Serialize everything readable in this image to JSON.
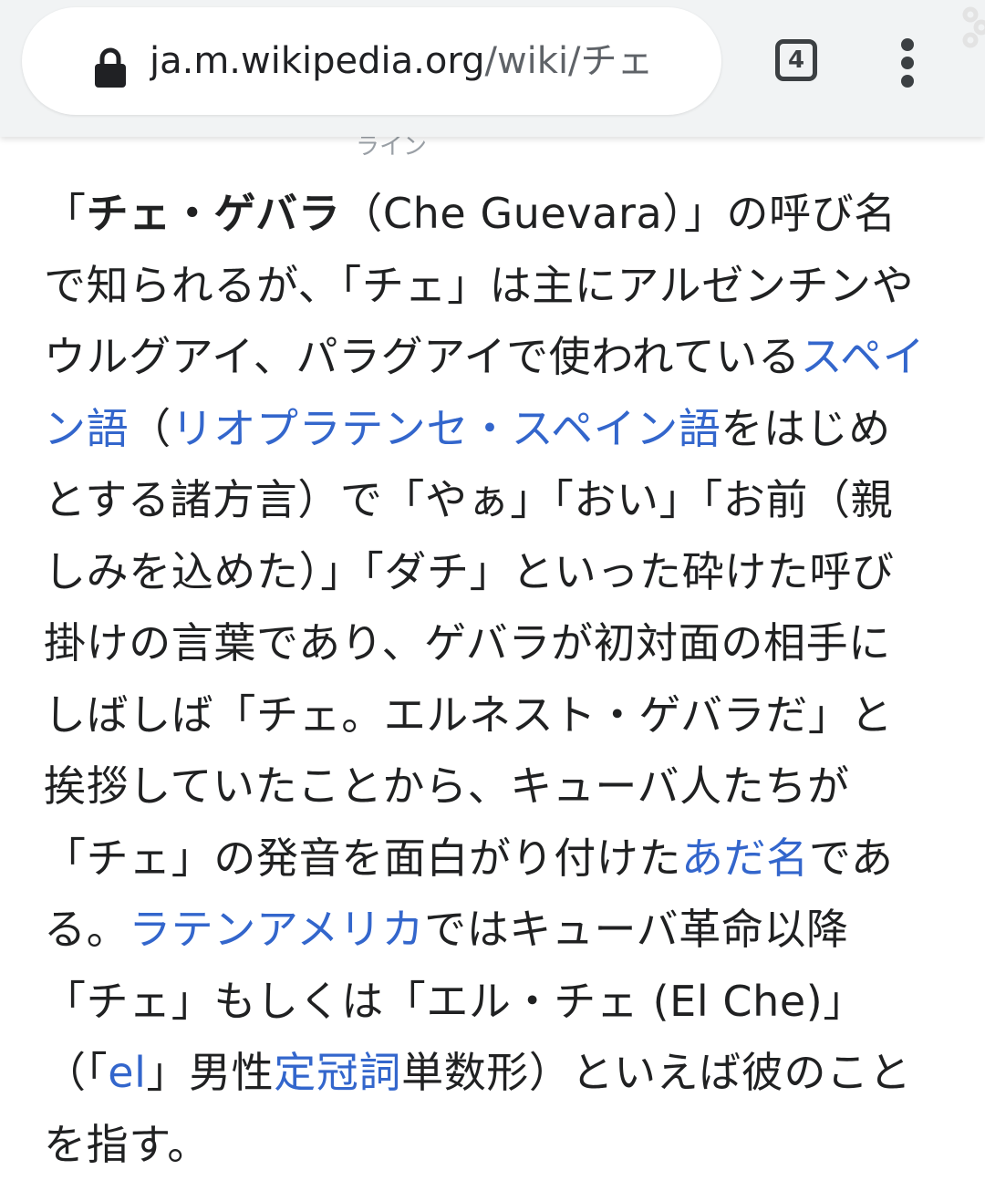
{
  "browser": {
    "url_domain": "ja.m.wikipedia.org",
    "url_path": "/wiki/チェ",
    "tab_count": "4"
  },
  "article": {
    "clipped_heading": "ライン",
    "paragraph": [
      {
        "t": "「"
      },
      {
        "t": "チェ・ゲバラ",
        "bold": true
      },
      {
        "t": "（Che Guevara）」の呼び名で知られるが、「チェ」は主にアルゼンチンやウルグアイ、パラグアイで使われている"
      },
      {
        "t": "スペイン語",
        "link": true
      },
      {
        "t": "（"
      },
      {
        "t": "リオプラテンセ・スペイン語",
        "link": true
      },
      {
        "t": "をはじめとする諸方言）で「やぁ」「おい」「お前（親しみを込めた）」「ダチ」といった砕けた呼び掛けの言葉であり、ゲバラが初対面の相手にしばしば「チェ。エルネスト・ゲバラだ」と挨拶していたことから、キューバ人たちが「チェ」の発音を面白がり付けた"
      },
      {
        "t": "あだ名",
        "link": true
      },
      {
        "t": "である。"
      },
      {
        "t": "ラテンアメリカ",
        "link": true
      },
      {
        "t": "ではキューバ革命以降「チェ」もしくは「エル・チェ (El Che)」（「"
      },
      {
        "t": "el",
        "link": true
      },
      {
        "t": "」男性"
      },
      {
        "t": "定冠詞",
        "link": true
      },
      {
        "t": "単数形）といえば彼のことを指す。"
      }
    ]
  },
  "colors": {
    "link": "#3366cc",
    "text": "#202122",
    "toolbar": "#f1f3f4"
  },
  "icons": [
    "lock-icon",
    "tab-switcher-icon",
    "more-options-icon"
  ]
}
